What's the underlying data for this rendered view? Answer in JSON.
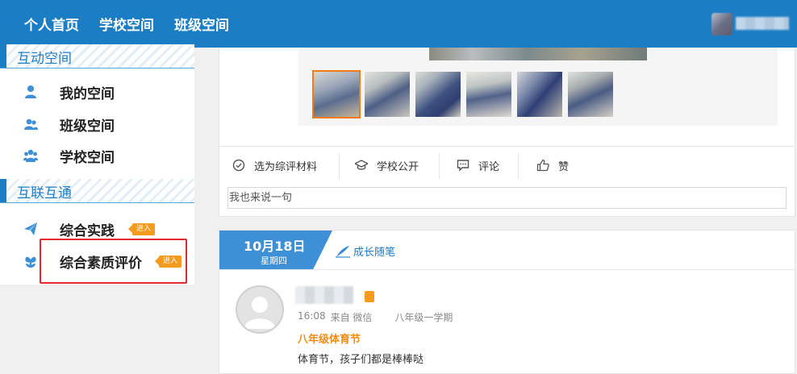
{
  "topnav": {
    "items": [
      "个人首页",
      "学校空间",
      "班级空间"
    ]
  },
  "sidebar": {
    "section1": {
      "title": "互动空间"
    },
    "items1": [
      {
        "label": "我的空间",
        "icon": "user-icon"
      },
      {
        "label": "班级空间",
        "icon": "users-icon"
      },
      {
        "label": "学校空间",
        "icon": "group-icon"
      }
    ],
    "section2": {
      "title": "互联互通"
    },
    "items2": [
      {
        "label": "综合实践",
        "icon": "paper-plane-icon",
        "badge": "进入"
      },
      {
        "label": "综合素质评价",
        "icon": "flower-icon",
        "badge": "进入"
      }
    ]
  },
  "post": {
    "actions": [
      {
        "label": "选为综评材料",
        "icon": "check-circle-icon"
      },
      {
        "label": "学校公开",
        "icon": "graduation-cap-icon"
      },
      {
        "label": "评论",
        "icon": "comment-icon"
      },
      {
        "label": "赞",
        "icon": "thumbs-up-icon"
      }
    ],
    "comment_placeholder": "我也来说一句"
  },
  "day": {
    "date": "10月18日",
    "weekday": "星期四",
    "category": "成长随笔",
    "entry": {
      "time": "16:08",
      "source": "来自 微信",
      "grade": "八年级一学期",
      "title": "八年级体育节",
      "body": "体育节，孩子们都是棒棒哒"
    }
  },
  "colors": {
    "brand_blue": "#1b7ec5",
    "accent_orange": "#f08d14",
    "highlight_red": "#e0282e"
  }
}
